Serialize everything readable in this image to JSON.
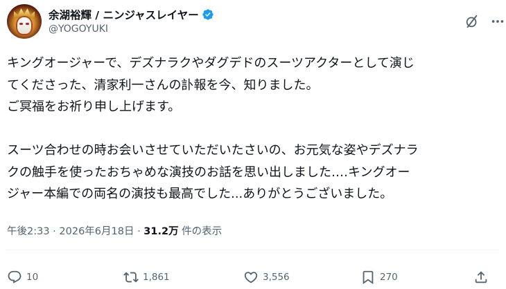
{
  "author": {
    "display_name": "余湖裕輝 / ニンジャスレイヤー",
    "handle": "@YOGOYUKI",
    "verified": true
  },
  "tweet": {
    "lines": [
      "キングオージャーで、デズナラクやダグデドのスーツアクターとして演じ",
      "てくださった、清家利一さんの訃報を今、知りました。",
      "ご冥福をお祈り申し上げます。",
      "",
      "スーツ合わせの時お会いさせていただいたさいの、お元気な姿やデズナラ",
      "クの触手を使ったおちゃめな演技のお話を思い出しました‥‥キングオー",
      "ジャー本編での両名の演技も最高でした...ありがとうございました。"
    ]
  },
  "meta": {
    "time": "午後2:33",
    "separator": " · ",
    "date": "2026年6月18日",
    "views_count": "31.2万",
    "views_label": " 件の表示"
  },
  "actions": {
    "reply": {
      "icon": "reply-icon",
      "count": "10"
    },
    "repost": {
      "icon": "repost-icon",
      "count": "1,861"
    },
    "like": {
      "icon": "heart-icon",
      "count": "3,556"
    },
    "bookmark": {
      "icon": "bookmark-icon",
      "count": "270"
    },
    "share": {
      "icon": "share-icon"
    }
  },
  "colors": {
    "text_primary": "#0f1419",
    "text_secondary": "#536471",
    "verified_blue": "#1d9bf0",
    "divider": "#eff3f4"
  }
}
